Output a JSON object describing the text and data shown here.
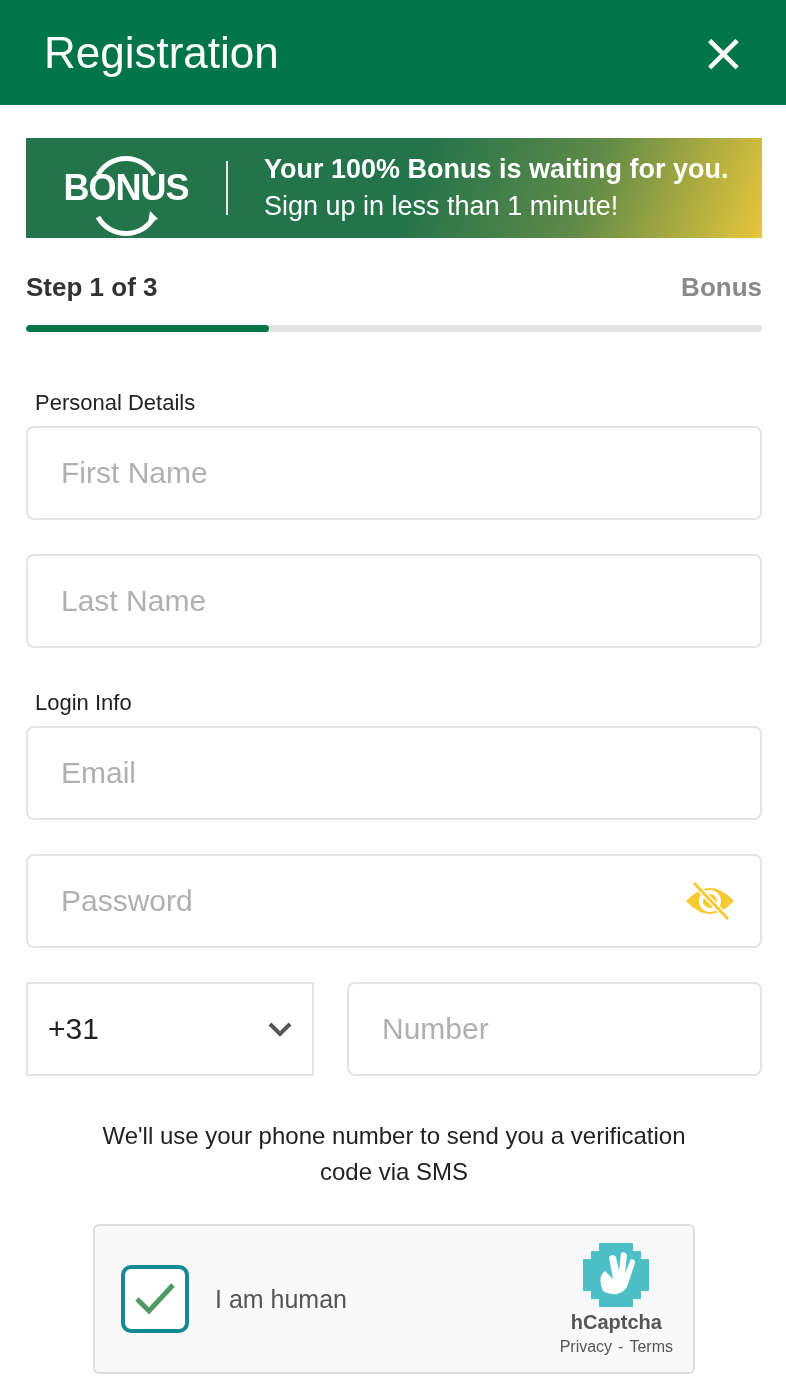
{
  "header": {
    "title": "Registration",
    "close": "×"
  },
  "banner": {
    "logo": "BONUS",
    "line_1": "Your 100% Bonus is waiting for you.",
    "line_2": "Sign up in less than 1 minute!"
  },
  "progress": {
    "step": "Step 1 of 3",
    "next": "Bonus",
    "level": 0.33
  },
  "sections": [
    {
      "label": "Personal Details",
      "fields": [
        {
          "kind": "text",
          "placeholder": "First Name"
        },
        {
          "kind": "text",
          "placeholder": "Last Name"
        }
      ]
    },
    {
      "label": "Login Info",
      "fields": [
        {
          "kind": "text",
          "placeholder": "Email"
        },
        {
          "kind": "password",
          "placeholder": "Password"
        }
      ]
    }
  ],
  "phone": {
    "country_code": "+31",
    "placeholder": "Number"
  },
  "note": "We'll use your phone number to send you a verification code via SMS",
  "captcha": {
    "checked": true,
    "label": "I am human",
    "brand": "hCaptcha",
    "links": [
      "Privacy",
      "Terms"
    ],
    "separator": "-"
  }
}
